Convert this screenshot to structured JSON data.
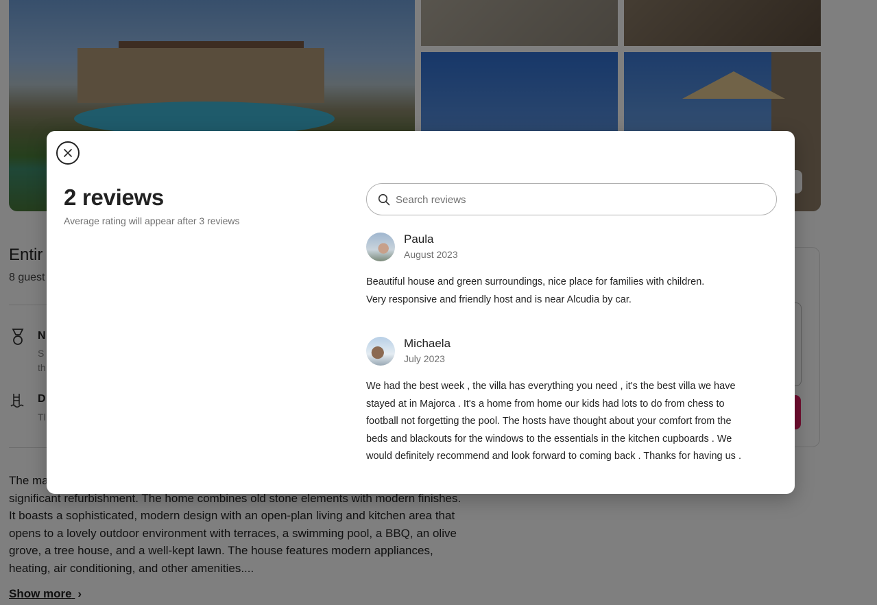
{
  "background": {
    "listing_title_fragment": "Entir",
    "guests_fragment": "8 guest",
    "highlight_1_initial": "N",
    "highlight_1_small": "S",
    "highlight_1_small2": "th",
    "highlight_2_initial": "D",
    "highlight_2_small": "Tl",
    "description_fragment_1": "The ma",
    "description_lines": [
      "significant refurbishment. The home combines old stone elements with modern finishes.",
      "It boasts a sophisticated, modern design with an open-plan living and kitchen area that",
      "opens to a lovely outdoor environment with terraces, a swimming pool, a BBQ, an olive",
      "grove, a tree house, and a well-kept lawn. The house features modern appliances,",
      "heating, air conditioning, and other amenities...."
    ],
    "show_more_label": "Show more",
    "show_more_icon": "chevron-right-icon"
  },
  "modal": {
    "close_icon": "close-icon",
    "title": "2 reviews",
    "subtitle": "Average rating will appear after 3 reviews",
    "search": {
      "placeholder": "Search reviews",
      "value": "",
      "icon": "search-icon"
    },
    "reviews": [
      {
        "name": "Paula",
        "date": "August 2023",
        "lines": [
          "Beautiful house and green surroundings, nice place for families with children.",
          "Very responsive and friendly host and is near Alcudia by car."
        ]
      },
      {
        "name": "Michaela",
        "date": "July 2023",
        "lines": [
          "We had the best week , the villa has everything you need , it's the best villa we have",
          "stayed at in Majorca . It's a home from home our kids had lots to do from chess to",
          "football not forgetting the pool. The hosts have thought about your comfort from the",
          "beds and blackouts for the windows to the essentials in the kitchen cupboards . We",
          "would definitely recommend and look forward to coming back . Thanks for having us ."
        ]
      }
    ]
  },
  "colors": {
    "overlay": "#000000",
    "accent": "#e11d61",
    "text_primary": "#222222",
    "text_secondary": "#717171"
  }
}
